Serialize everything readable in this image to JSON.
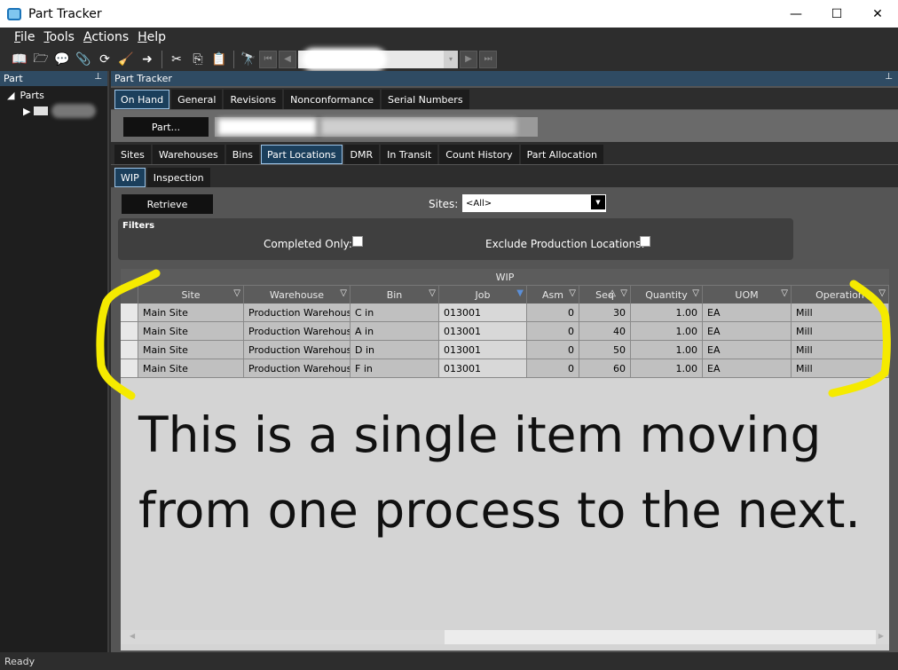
{
  "window": {
    "title": "Part Tracker"
  },
  "window_controls": {
    "minimize": "—",
    "maximize": "☐",
    "close": "✕"
  },
  "menu": [
    {
      "label": "File",
      "accel": "F",
      "rest": "ile"
    },
    {
      "label": "Tools",
      "accel": "T",
      "rest": "ools"
    },
    {
      "label": "Actions",
      "accel": "A",
      "rest": "ctions"
    },
    {
      "label": "Help",
      "accel": "H",
      "rest": "elp"
    }
  ],
  "left_panel": {
    "title": "Part",
    "pin": "📌",
    "tree_root": "Parts"
  },
  "main_panel": {
    "title": "Part Tracker",
    "pin": "📌"
  },
  "tabs_level1": [
    {
      "label": "On Hand",
      "active": true
    },
    {
      "label": "General",
      "active": false
    },
    {
      "label": "Revisions",
      "active": false
    },
    {
      "label": "Nonconformance",
      "active": false
    },
    {
      "label": "Serial Numbers",
      "active": false
    }
  ],
  "part_button": "Part...",
  "tabs_level2": [
    {
      "label": "Sites",
      "active": false
    },
    {
      "label": "Warehouses",
      "active": false
    },
    {
      "label": "Bins",
      "active": false
    },
    {
      "label": "Part Locations",
      "active": true
    },
    {
      "label": "DMR",
      "active": false
    },
    {
      "label": "In Transit",
      "active": false
    },
    {
      "label": "Count History",
      "active": false
    },
    {
      "label": "Part Allocation",
      "active": false
    }
  ],
  "tabs_level3": [
    {
      "label": "WIP",
      "active": true
    },
    {
      "label": "Inspection",
      "active": false
    }
  ],
  "retrieve_button": "Retrieve",
  "sites": {
    "label": "Sites:",
    "value": "<All>"
  },
  "filters": {
    "title": "Filters",
    "completed_only": "Completed Only:",
    "exclude_production": "Exclude Production Locations:"
  },
  "grid": {
    "band_title": "WIP",
    "columns": [
      "Site",
      "Warehouse",
      "Bin",
      "Job",
      "Asm",
      "Seq",
      "Quantity",
      "UOM",
      "Operation"
    ],
    "rows": [
      [
        "Main Site",
        "Production Warehous",
        "C in",
        "013001",
        "0",
        "30",
        "1.00",
        "EA",
        "Mill"
      ],
      [
        "Main Site",
        "Production Warehous",
        "A in",
        "013001",
        "0",
        "40",
        "1.00",
        "EA",
        "Mill"
      ],
      [
        "Main Site",
        "Production Warehous",
        "D in",
        "013001",
        "0",
        "50",
        "1.00",
        "EA",
        "Mill"
      ],
      [
        "Main Site",
        "Production Warehous",
        "F in",
        "013001",
        "0",
        "60",
        "1.00",
        "EA",
        "Mill"
      ]
    ]
  },
  "annotation": {
    "line1": "This is a single item moving",
    "line2": "from one process to the next.",
    "color": "#f5ea00"
  },
  "status": "Ready"
}
